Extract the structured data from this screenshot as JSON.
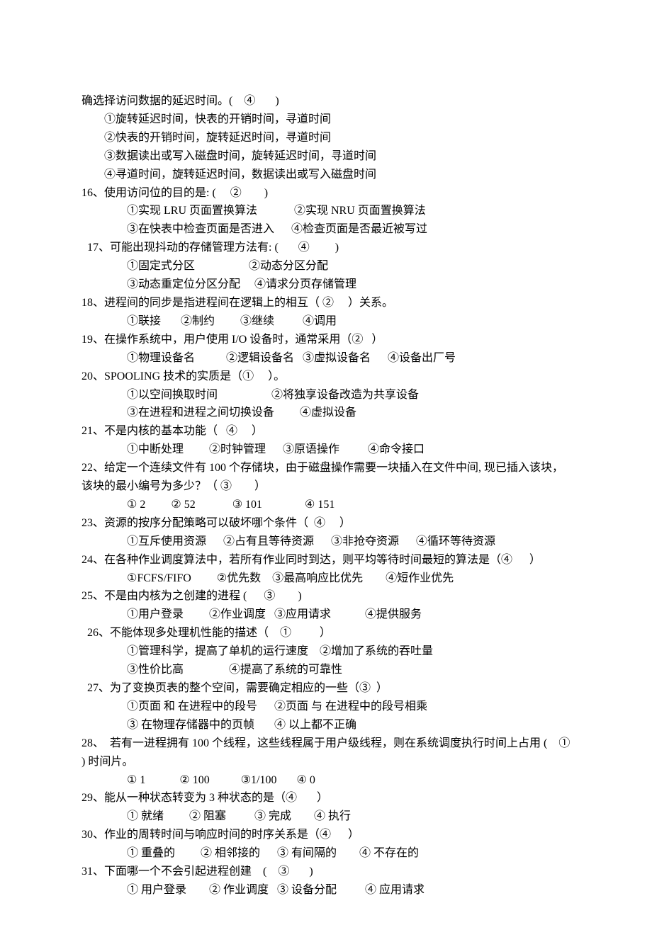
{
  "lines": [
    {
      "cls": "",
      "text": "确选择访问数据的延迟时间。(    ④       )"
    },
    {
      "cls": "indent1",
      "text": "①旋转延迟时间，快表的开销时间，寻道时间"
    },
    {
      "cls": "indent1",
      "text": "②快表的开销时间，旋转延迟时间，寻道时间"
    },
    {
      "cls": "indent1",
      "text": "③数据读出或写入磁盘时间，旋转延迟时间，寻道时间"
    },
    {
      "cls": "indent1",
      "text": "④寻道时间，旋转延迟时间，数据读出或写入磁盘时间"
    },
    {
      "cls": "",
      "text": "16、使用访问位的目的是: (     ②        )"
    },
    {
      "cls": "indent2",
      "text": "①实现 LRU 页面置换算法             ②实现 NRU 页面置换算法"
    },
    {
      "cls": "indent2",
      "text": "③在快表中检查页面是否进入      ④检查页面是否最近被写过"
    },
    {
      "cls": "indent05",
      "text": "17、可能出现抖动的存储管理方法有: (       ④         )"
    },
    {
      "cls": "indent2",
      "text": "①固定式分区                   ②动态分区分配"
    },
    {
      "cls": "indent2",
      "text": "③动态重定位分区分配     ④请求分页存储管理"
    },
    {
      "cls": "",
      "text": "18、进程间的同步是指进程间在逻辑上的相互（ ②     ）关系。"
    },
    {
      "cls": "indent2",
      "text": "①联接       ②制约         ③继续          ④调用"
    },
    {
      "cls": "",
      "text": "19、在操作系统中，用户使用 I/O 设备时，通常采用（②   ）"
    },
    {
      "cls": "indent2",
      "text": "①物理设备名           ②逻辑设备名   ③虚拟设备名      ④设备出厂号"
    },
    {
      "cls": "",
      "text": "20、SPOOLING 技术的实质是（①     ）。"
    },
    {
      "cls": "indent2",
      "text": "①以空间换取时间                   ②将独享设备改造为共享设备"
    },
    {
      "cls": "indent2",
      "text": "③在进程和进程之间切换设备         ④虚拟设备"
    },
    {
      "cls": "",
      "text": "21、不是内核的基本功能（   ④     ）"
    },
    {
      "cls": "indent2",
      "text": "①中断处理         ②时钟管理      ③原语操作          ④命令接口"
    },
    {
      "cls": "",
      "text": "22、给定一个连续文件有 100 个存储块，由于磁盘操作需要一块插入在文件中间, 现已插入该块，该块的最小编号为多少？（ ③        ）"
    },
    {
      "cls": "indent2",
      "text": "① 2         ② 52             ③ 101               ④ 151"
    },
    {
      "cls": "",
      "text": "23、资源的按序分配策略可以破坏哪个条件（  ④     ）"
    },
    {
      "cls": "indent2",
      "text": "①互斥使用资源      ②占有且等待资源      ③非抢夺资源      ④循环等待资源"
    },
    {
      "cls": "",
      "text": "24、在各种作业调度算法中，若所有作业同时到达，则平均等待时间最短的算法是（④      ）"
    },
    {
      "cls": "indent2",
      "text": "①FCFS/FIFO         ②优先数    ③最高响应比优先        ④短作业优先"
    },
    {
      "cls": "",
      "text": "25、不是由内核为之创建的进程 (      ③        )"
    },
    {
      "cls": "indent2",
      "text": "①用户登录         ②作业调度   ③应用请求            ④提供服务"
    },
    {
      "cls": "indent05",
      "text": "26、不能体现多处理机性能的描述（    ①          ）"
    },
    {
      "cls": "indent2",
      "text": "①管理科学，提高了单机的运行速度    ②增加了系统的吞吐量"
    },
    {
      "cls": "indent2",
      "text": "③性价比高                ④提高了系统的可靠性"
    },
    {
      "cls": "indent05",
      "text": "27、为了变换页表的整个空间，需要确定相应的一些（③  ）"
    },
    {
      "cls": "indent2",
      "text": "①页面 和 在进程中的段号      ②页面 与 在进程中的段号相乘"
    },
    {
      "cls": "indent2",
      "text": "③ 在物理存储器中的页帧       ④ 以上都不正确"
    },
    {
      "cls": "",
      "text": "28、  若有一进程拥有 100 个线程，这些线程属于用户级线程，则在系统调度执行时间上占用 (    ①   ) 时间片。"
    },
    {
      "cls": "indent2",
      "text": "① 1            ② 100           ③1/100       ④ 0"
    },
    {
      "cls": "",
      "text": "29、能从一种状态转变为 3 种状态的是（④       ）"
    },
    {
      "cls": "indent2",
      "text": "① 就绪         ② 阻塞          ③ 完成        ④ 执行"
    },
    {
      "cls": "",
      "text": "30、作业的周转时间与响应时间的时序关系是（④      ）"
    },
    {
      "cls": "indent2",
      "text": "① 重叠的         ② 相邻接的      ③ 有间隔的        ④ 不存在的"
    },
    {
      "cls": "",
      "text": "31、下面哪一个不会引起进程创建    (    ③       )"
    },
    {
      "cls": "indent2",
      "text": "① 用户登录        ② 作业调度   ③ 设备分配          ④ 应用请求"
    }
  ]
}
